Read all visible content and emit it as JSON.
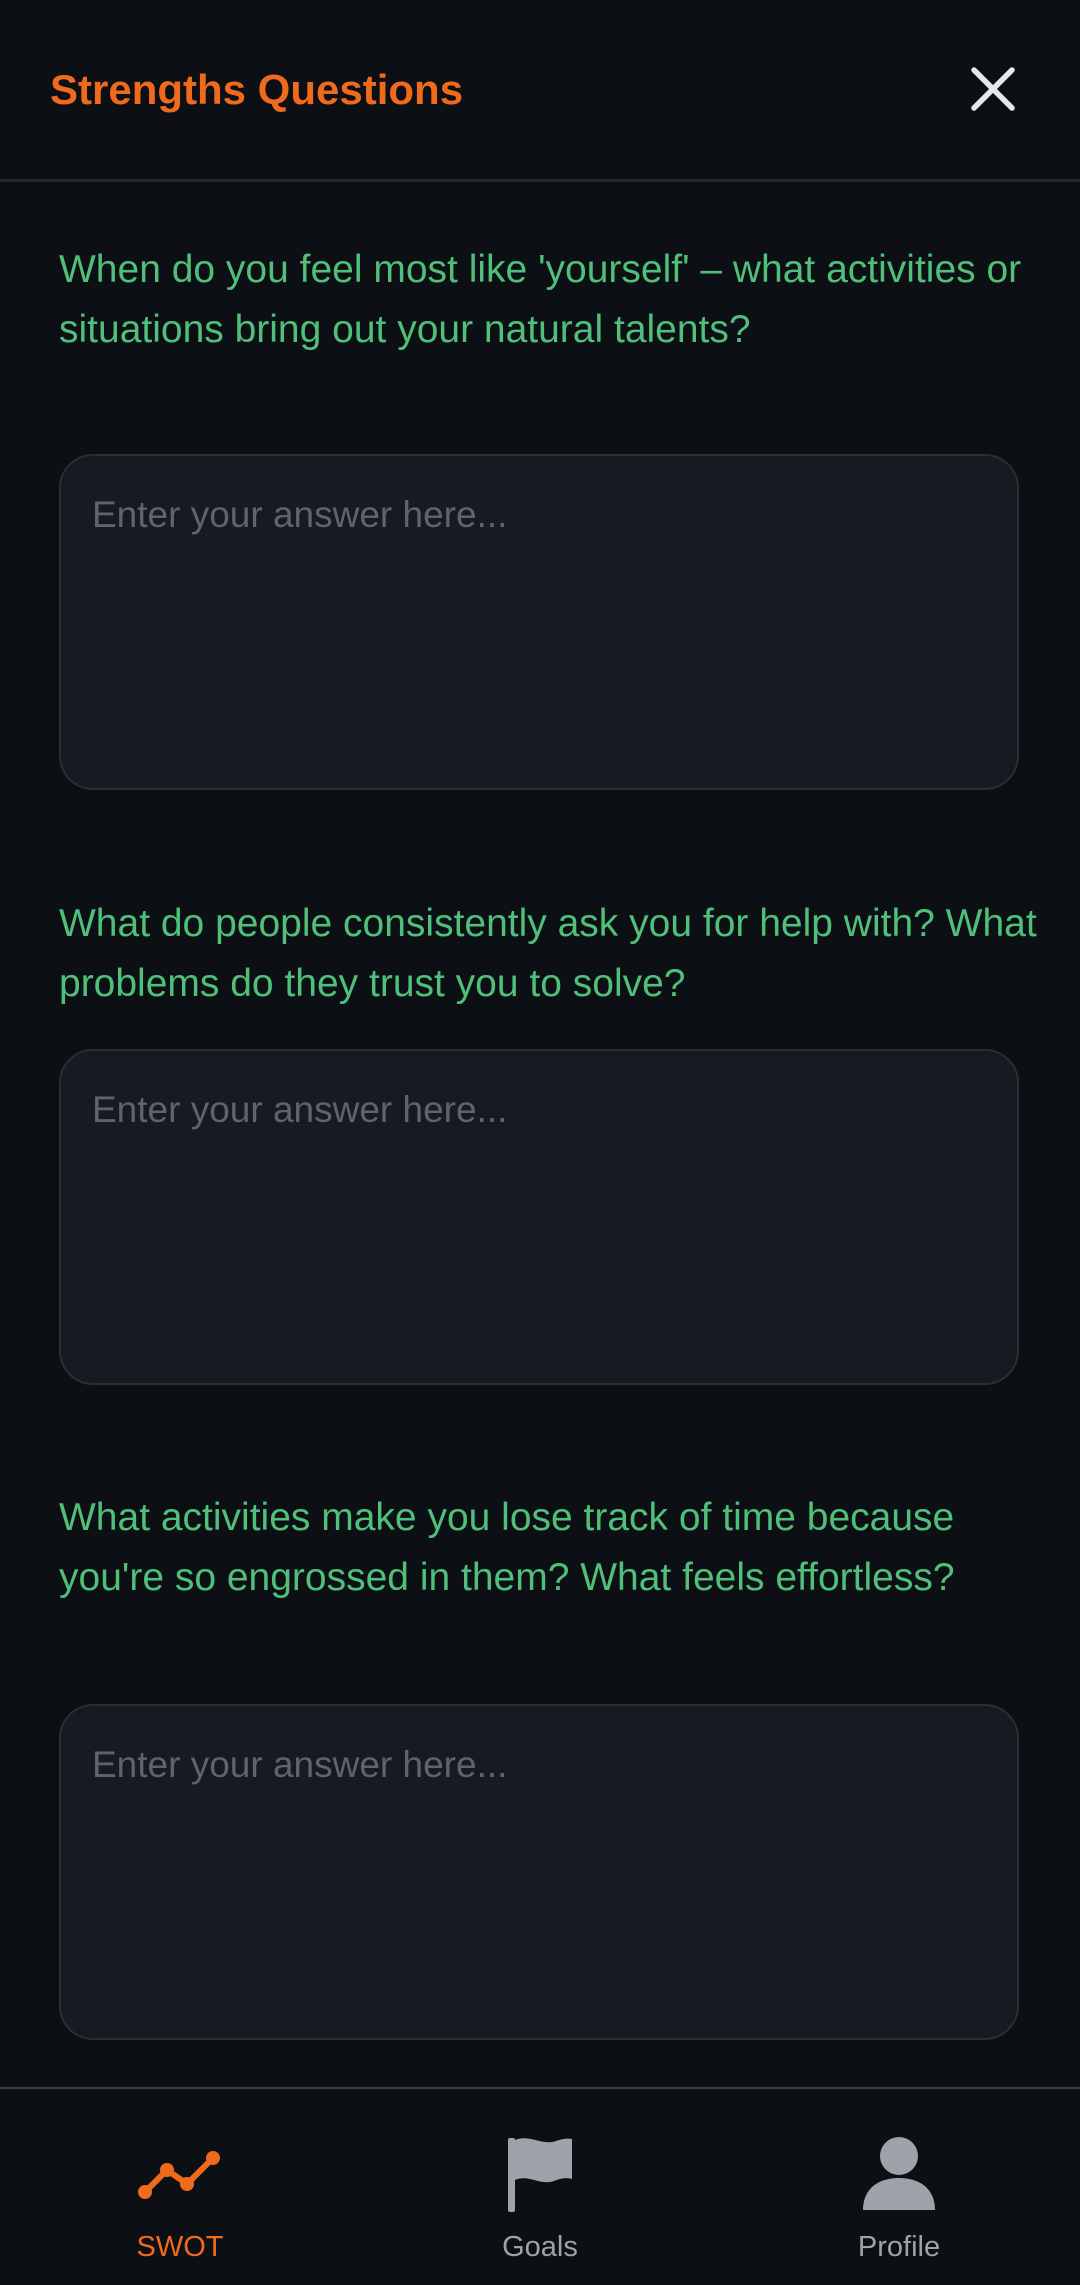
{
  "header": {
    "title": "Strengths Questions",
    "close_icon": "close-icon"
  },
  "questions": [
    {
      "text": "When do you feel most like 'yourself' – what activities or situations bring out your natural talents?",
      "answer_value": "",
      "placeholder": "Enter your answer here..."
    },
    {
      "text": "What do people consistently ask you for help with? What problems do they trust you to solve?",
      "answer_value": "",
      "placeholder": "Enter your answer here..."
    },
    {
      "text": "What activities make you lose track of time because you're so engrossed in them? What feels effortless?",
      "answer_value": "",
      "placeholder": "Enter your answer here..."
    }
  ],
  "bottom_nav": {
    "items": [
      {
        "label": "SWOT",
        "icon": "trend-line-icon",
        "active": true
      },
      {
        "label": "Goals",
        "icon": "flag-icon",
        "active": false
      },
      {
        "label": "Profile",
        "icon": "person-icon",
        "active": false
      }
    ]
  },
  "colors": {
    "background": "#0c0f14",
    "accent": "#f06a1d",
    "question_text": "#4fbf7a",
    "input_background": "#171a20",
    "input_border": "#2a2e35",
    "placeholder": "#5d6370",
    "nav_inactive": "#9ea2a9",
    "close_icon": "#e6e7ea"
  }
}
